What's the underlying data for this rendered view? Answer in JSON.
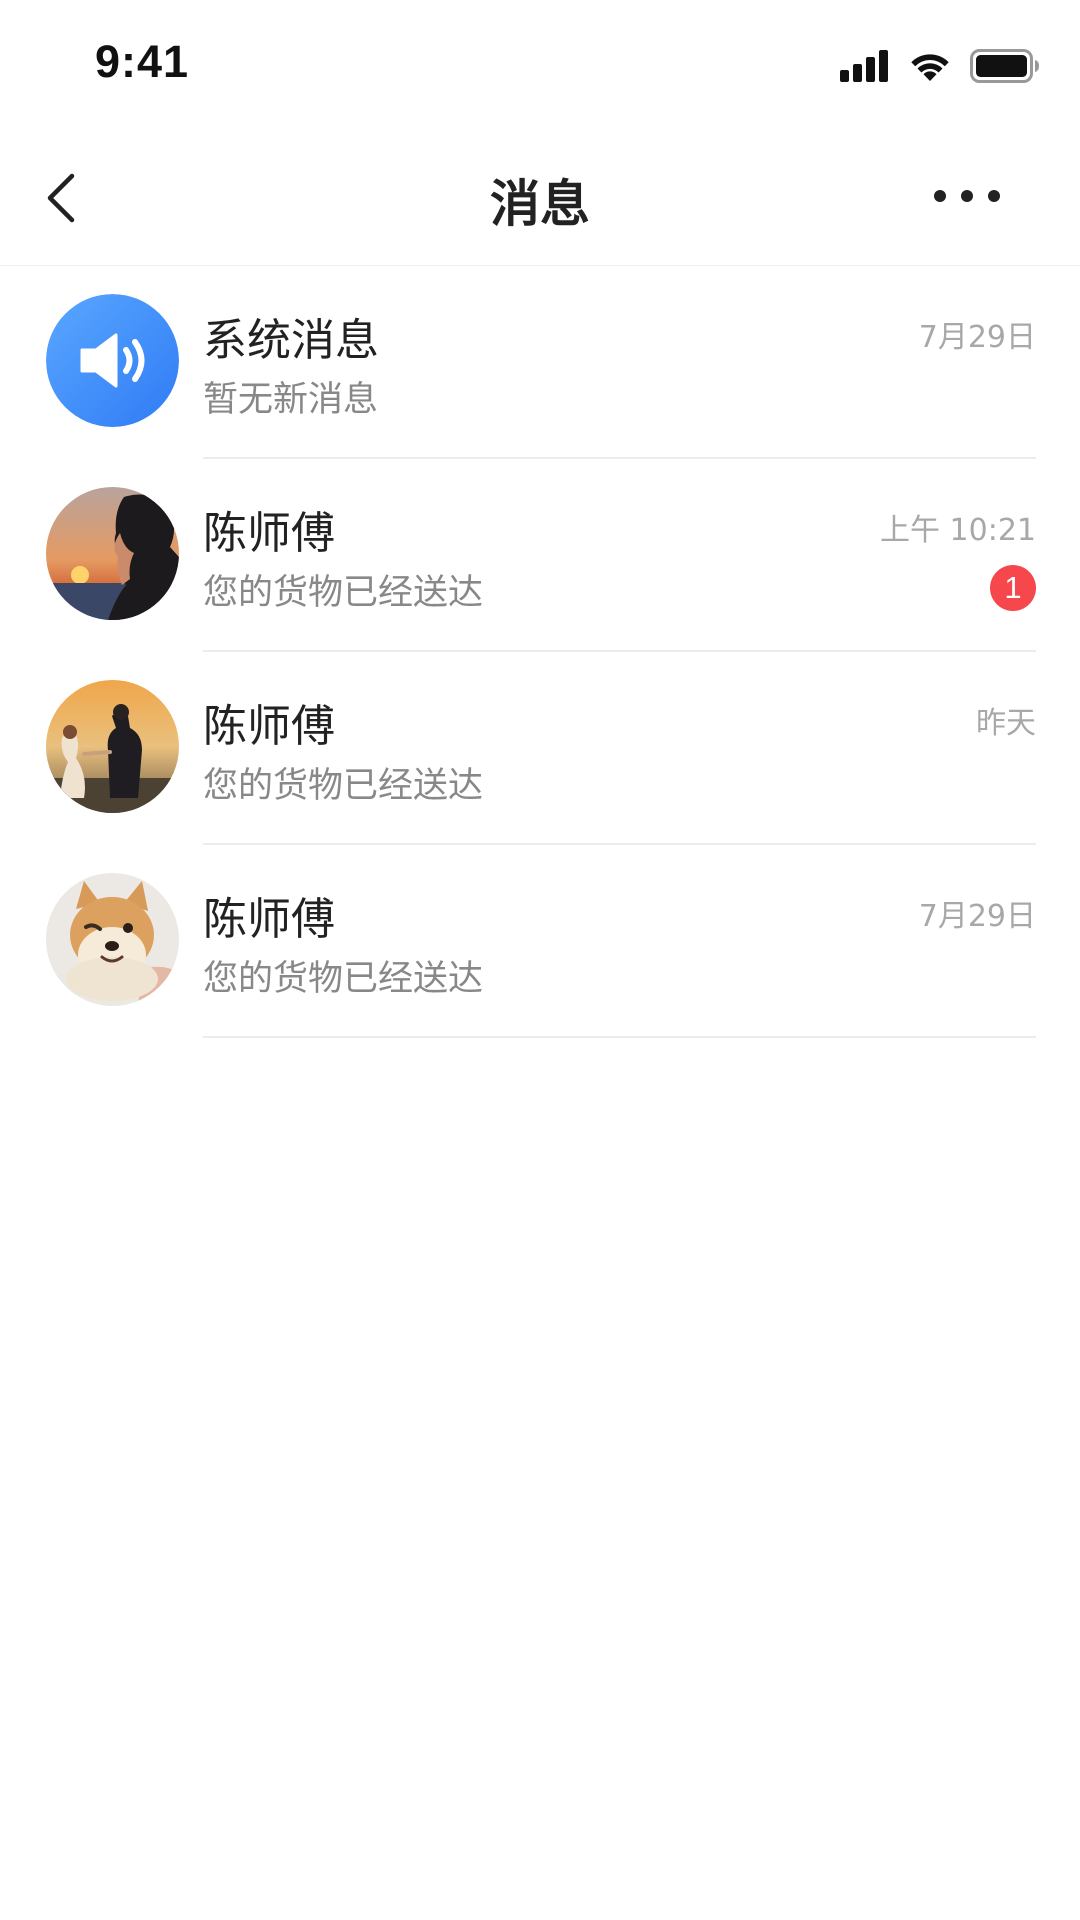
{
  "status_bar": {
    "time": "9:41"
  },
  "nav": {
    "title": "消息"
  },
  "messages": [
    {
      "avatar": "speaker-icon",
      "name": "系统消息",
      "preview": "暂无新消息",
      "time": "7月29日",
      "badge": ""
    },
    {
      "avatar": "photo-man-sunset",
      "name": "陈师傅",
      "preview": "您的货物已经送达",
      "time": "上午 10:21",
      "badge": "1"
    },
    {
      "avatar": "photo-couple-sunset",
      "name": "陈师傅",
      "preview": "您的货物已经送达",
      "time": "昨天",
      "badge": ""
    },
    {
      "avatar": "photo-shiba-dog",
      "name": "陈师傅",
      "preview": "您的货物已经送达",
      "time": "7月29日",
      "badge": ""
    }
  ],
  "colors": {
    "badge": "#f5474c",
    "system_avatar_start": "#5aa7ff",
    "system_avatar_end": "#2f7bf5"
  }
}
